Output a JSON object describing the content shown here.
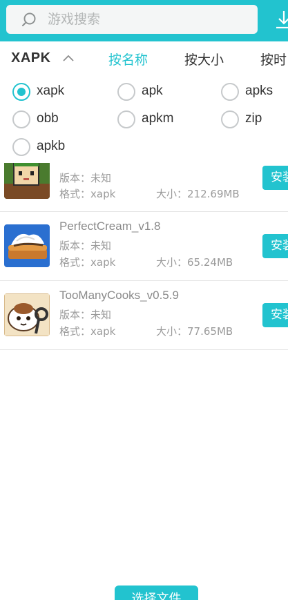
{
  "search": {
    "placeholder": "游戏搜索"
  },
  "filter": {
    "type_label": "XAPK",
    "sort_tabs": [
      {
        "label": "按名称",
        "active": true
      },
      {
        "label": "按大小",
        "active": false
      },
      {
        "label": "按时",
        "active": false
      }
    ]
  },
  "formats": [
    {
      "label": "xapk",
      "checked": true
    },
    {
      "label": "apk",
      "checked": false
    },
    {
      "label": "apks",
      "checked": false
    },
    {
      "label": "obb",
      "checked": false
    },
    {
      "label": "apkm",
      "checked": false
    },
    {
      "label": "zip",
      "checked": false
    },
    {
      "label": "apkb",
      "checked": false
    }
  ],
  "items": [
    {
      "name": "",
      "version": "版本：未知",
      "format": "格式：xapk",
      "size": "大小：212.69MB",
      "install_label": "安装"
    },
    {
      "name": "PerfectCream_v1.8",
      "version": "版本：未知",
      "format": "格式：xapk",
      "size": "大小：65.24MB",
      "install_label": "安装"
    },
    {
      "name": "TooManyCooks_v0.5.9",
      "version": "版本：未知",
      "format": "格式：xapk",
      "size": "大小：77.65MB",
      "install_label": "安装"
    }
  ],
  "footer": {
    "select_file_label": "选择文件"
  },
  "colors": {
    "accent": "#22c3cf",
    "text": "#333333",
    "muted": "#9a9a9a"
  }
}
